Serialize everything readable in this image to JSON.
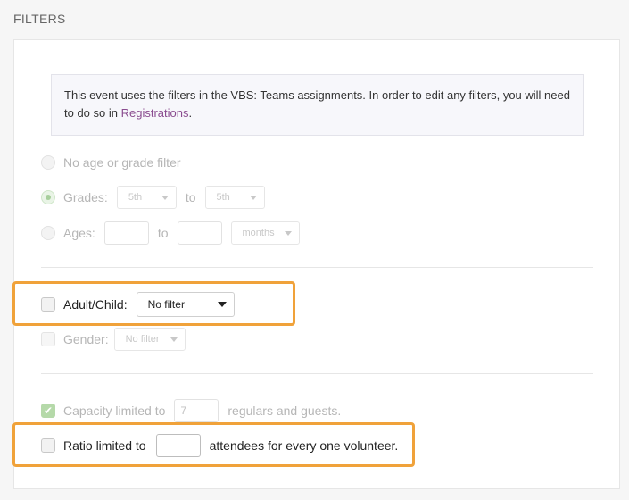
{
  "section": {
    "title": "FILTERS"
  },
  "notice": {
    "text_before": "This event uses the filters in the VBS: Teams assignments. In order to edit any filters, you will need to do so in ",
    "link": "Registrations",
    "text_after": "."
  },
  "age_grade": {
    "no_filter_label": "No age or grade filter",
    "grades_label": "Grades:",
    "grades_from": "5th",
    "grades_to_word": "to",
    "grades_to": "5th",
    "ages_label": "Ages:",
    "ages_to_word": "to",
    "ages_from_value": "",
    "ages_to_value": "",
    "ages_unit": "months",
    "selected": "grades"
  },
  "adult_child": {
    "label": "Adult/Child:",
    "value": "No filter",
    "checked": false
  },
  "gender": {
    "label": "Gender:",
    "value": "No filter",
    "checked": false
  },
  "capacity": {
    "label_before": "Capacity limited to",
    "value": "7",
    "label_after": "regulars and guests.",
    "checked": true
  },
  "ratio": {
    "label_before": "Ratio limited to",
    "value": "",
    "label_after": "attendees for every one volunteer.",
    "checked": false
  },
  "colors": {
    "highlight": "#f0a23a",
    "link": "#8a4c8f",
    "check_green": "#b5d9a9"
  }
}
